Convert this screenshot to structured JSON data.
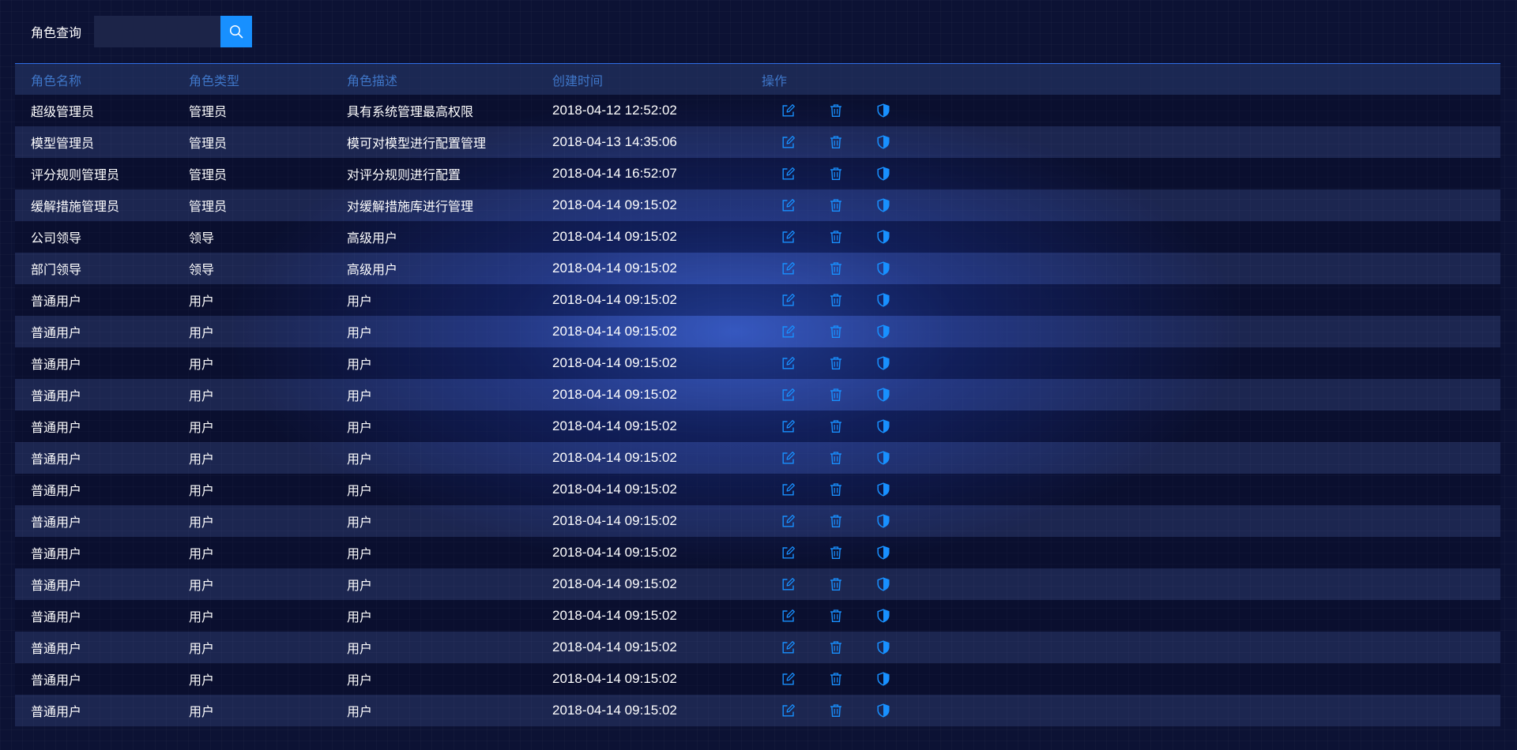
{
  "search": {
    "label": "角色查询",
    "value": "",
    "placeholder": ""
  },
  "icons": {
    "search": "search-icon",
    "edit": "edit-icon",
    "delete": "trash-icon",
    "permission": "shield-icon"
  },
  "colors": {
    "accent": "#1890ff",
    "header_text": "#3f76c8",
    "action_icon": "#1890ff"
  },
  "table": {
    "headers": [
      "角色名称",
      "角色类型",
      "角色描述",
      "创建时间",
      "操作"
    ],
    "rows": [
      [
        "超级管理员",
        "管理员",
        "具有系统管理最高权限",
        "2018-04-12 12:52:02"
      ],
      [
        "模型管理员",
        "管理员",
        "模可对模型进行配置管理",
        "2018-04-13 14:35:06"
      ],
      [
        "评分规则管理员",
        "管理员",
        "对评分规则进行配置",
        "2018-04-14 16:52:07"
      ],
      [
        "缓解措施管理员",
        "管理员",
        "对缓解措施库进行管理",
        "2018-04-14 09:15:02"
      ],
      [
        "公司领导",
        "领导",
        "高级用户",
        "2018-04-14 09:15:02"
      ],
      [
        "部门领导",
        "领导",
        "高级用户",
        "2018-04-14 09:15:02"
      ],
      [
        "普通用户",
        "用户",
        "用户",
        "2018-04-14 09:15:02"
      ],
      [
        "普通用户",
        "用户",
        "用户",
        "2018-04-14 09:15:02"
      ],
      [
        "普通用户",
        "用户",
        "用户",
        "2018-04-14 09:15:02"
      ],
      [
        "普通用户",
        "用户",
        "用户",
        "2018-04-14 09:15:02"
      ],
      [
        "普通用户",
        "用户",
        "用户",
        "2018-04-14 09:15:02"
      ],
      [
        "普通用户",
        "用户",
        "用户",
        "2018-04-14 09:15:02"
      ],
      [
        "普通用户",
        "用户",
        "用户",
        "2018-04-14 09:15:02"
      ],
      [
        "普通用户",
        "用户",
        "用户",
        "2018-04-14 09:15:02"
      ],
      [
        "普通用户",
        "用户",
        "用户",
        "2018-04-14 09:15:02"
      ],
      [
        "普通用户",
        "用户",
        "用户",
        "2018-04-14 09:15:02"
      ],
      [
        "普通用户",
        "用户",
        "用户",
        "2018-04-14 09:15:02"
      ],
      [
        "普通用户",
        "用户",
        "用户",
        "2018-04-14 09:15:02"
      ],
      [
        "普通用户",
        "用户",
        "用户",
        "2018-04-14 09:15:02"
      ],
      [
        "普通用户",
        "用户",
        "用户",
        "2018-04-14 09:15:02"
      ]
    ]
  }
}
